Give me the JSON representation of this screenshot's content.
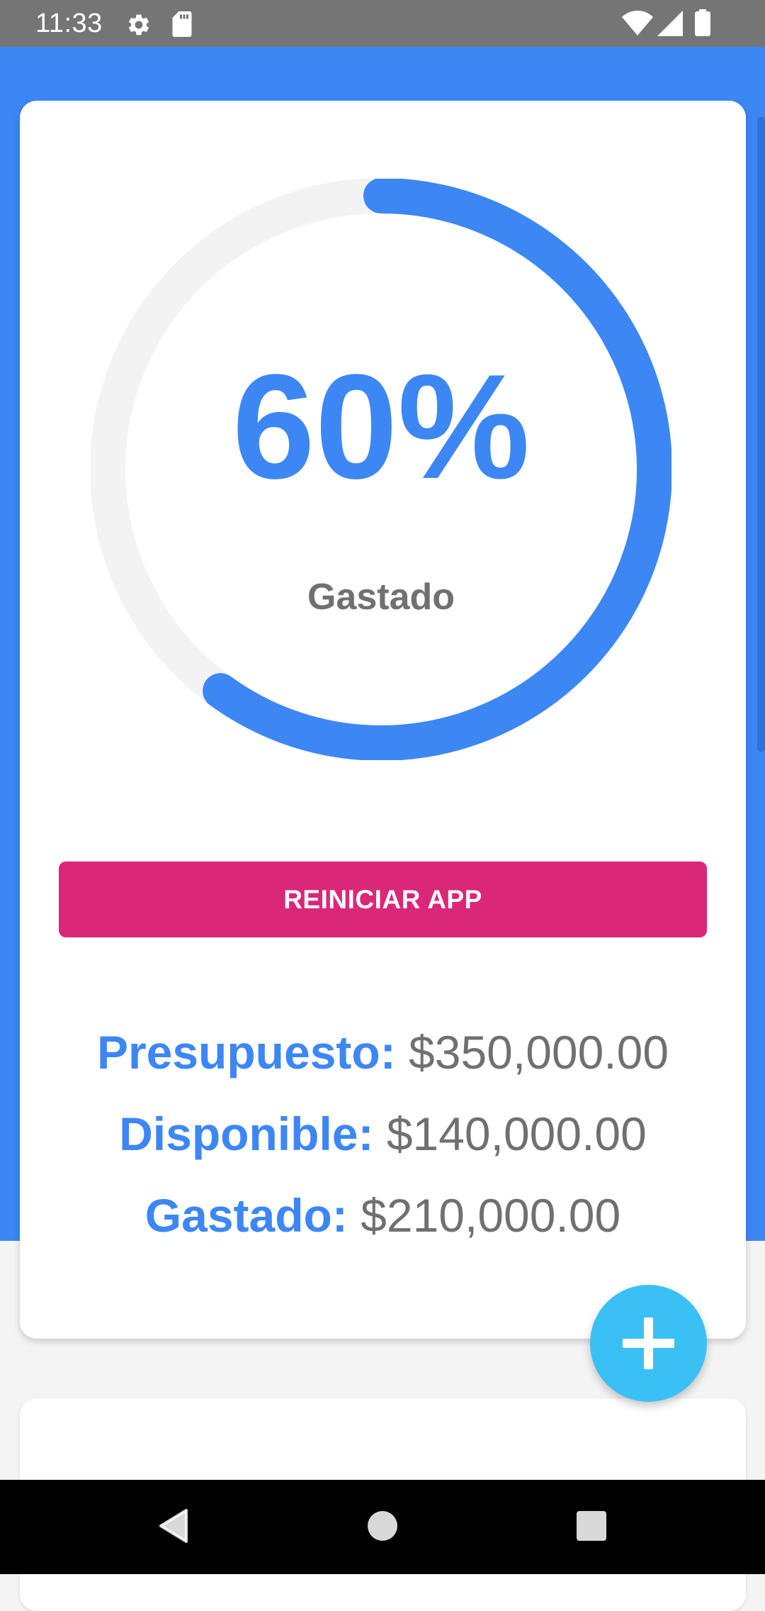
{
  "status_bar": {
    "time": "11:33",
    "icons": [
      "settings-icon",
      "sd-card-icon",
      "wifi-icon",
      "signal-icon",
      "battery-icon"
    ]
  },
  "budget": {
    "percent_spent": 60,
    "percent_text": "60%",
    "spent_label": "Gastado",
    "reset_button_label": "REINICIAR APP",
    "rows": [
      {
        "label": "Presupuesto:",
        "value": "$350,000.00"
      },
      {
        "label": "Disponible:",
        "value": "$140,000.00"
      },
      {
        "label": "Gastado:",
        "value": "$210,000.00"
      }
    ]
  },
  "fab": {
    "icon": "plus-icon"
  },
  "nav_bar": {
    "icons": [
      "back-icon",
      "home-icon",
      "recents-icon"
    ]
  },
  "colors": {
    "primary": "#3d87f5",
    "progress_track": "#f3f3f3",
    "reset_button": "#db2777",
    "fab": "#3bc0f6",
    "muted_text": "#707070",
    "status_bar": "#757575",
    "background": "#f4f4f4"
  }
}
